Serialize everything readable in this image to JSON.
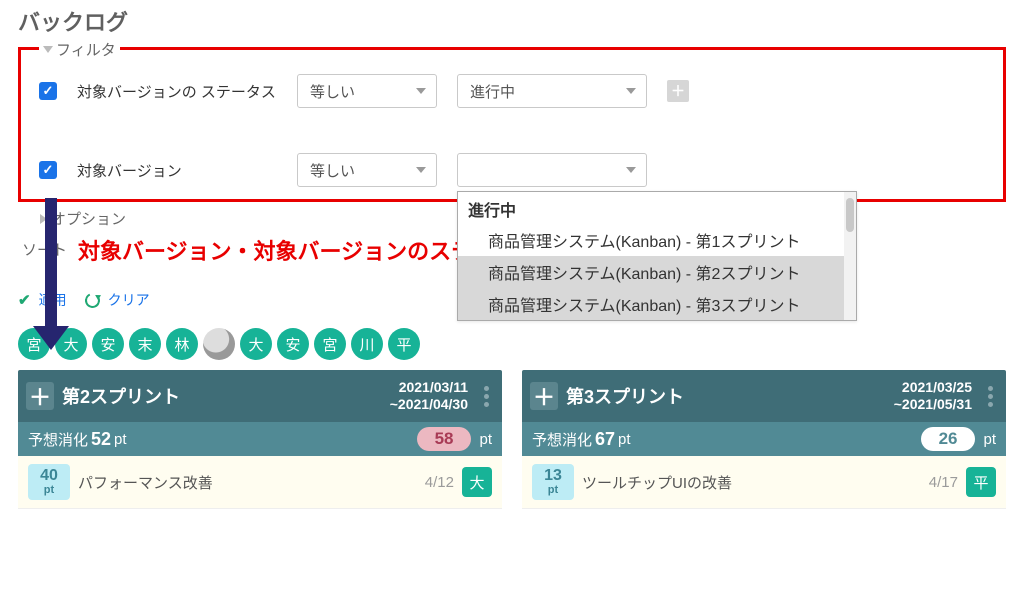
{
  "page_title": "バックログ",
  "filter": {
    "legend": "フィルタ",
    "rows": [
      {
        "checked": true,
        "field": "対象バージョンの ステータス",
        "operator": "等しい",
        "value": "進行中"
      },
      {
        "checked": true,
        "field": "対象バージョン",
        "operator": "等しい",
        "value_dropdown": {
          "group_label": "進行中",
          "options": [
            {
              "label": "商品管理システム(Kanban) - 第1スプリント",
              "selected": false
            },
            {
              "label": "商品管理システム(Kanban) - 第2スプリント",
              "selected": true
            },
            {
              "label": "商品管理システム(Kanban) - 第3スプリント",
              "selected": true
            }
          ]
        }
      }
    ]
  },
  "options_label": "オプション",
  "sort_prefix": "ソート",
  "annotation_text": "対象バージョン・対象バージョンのステータスでフィルタリング",
  "actions": {
    "apply": "適用",
    "clear": "クリア"
  },
  "avatars": [
    "宮",
    "大",
    "安",
    "末",
    "林",
    "",
    "大",
    "安",
    "宮",
    "川",
    "平"
  ],
  "sprints": [
    {
      "title": "第2スプリント",
      "date_from": "2021/03/11",
      "date_to": "~2021/04/30",
      "est_label": "予想消化",
      "est_value": "52",
      "est_unit": "pt",
      "badge": "58",
      "badge_style": "pink",
      "items": [
        {
          "points": "40",
          "unit": "pt",
          "title": "パフォーマンス改善",
          "date": "4/12",
          "tag": "大"
        }
      ]
    },
    {
      "title": "第3スプリント",
      "date_from": "2021/03/25",
      "date_to": "~2021/05/31",
      "est_label": "予想消化",
      "est_value": "67",
      "est_unit": "pt",
      "badge": "26",
      "badge_style": "white",
      "items": [
        {
          "points": "13",
          "unit": "pt",
          "title": "ツールチップUIの改善",
          "date": "4/17",
          "tag": "平"
        }
      ]
    }
  ]
}
